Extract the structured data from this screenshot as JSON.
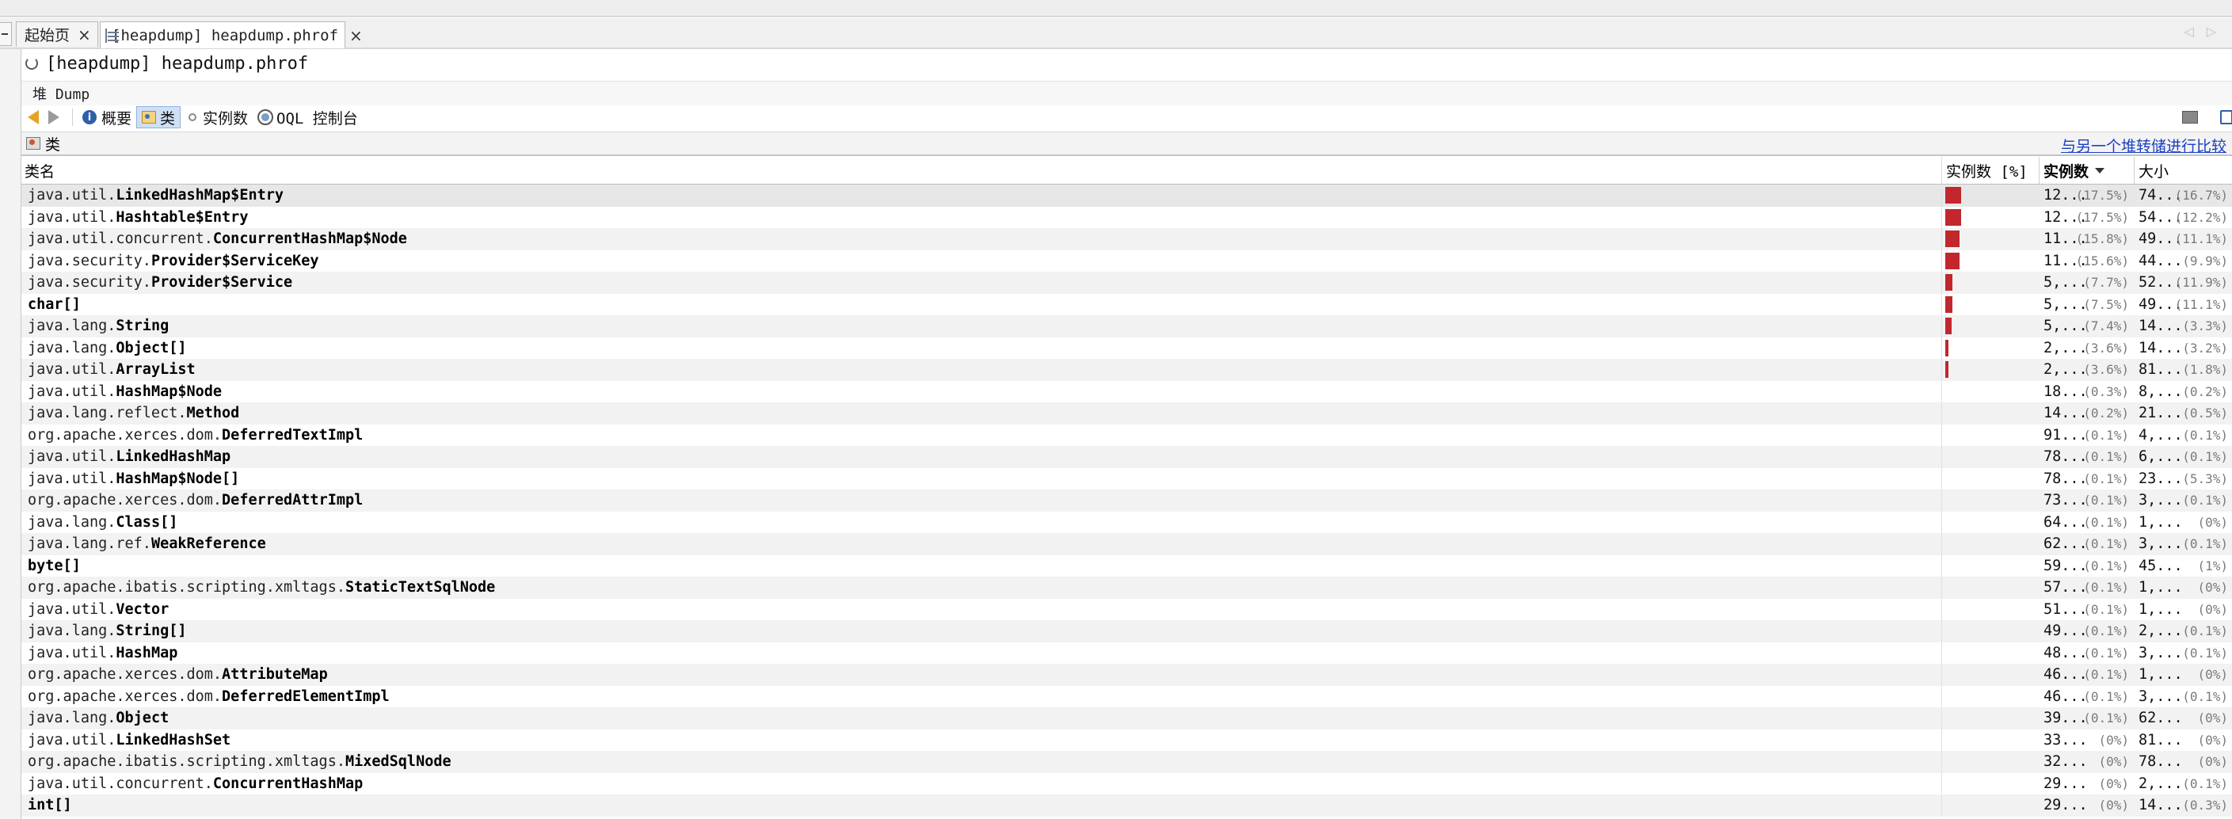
{
  "tabs": [
    {
      "label": "起始页",
      "close": "×"
    },
    {
      "label": "[heapdump] heapdump.phrof",
      "close": "×"
    }
  ],
  "tab_nav": {
    "left": "◁",
    "right": "▷"
  },
  "document": {
    "title": "[heapdump] heapdump.phrof",
    "heap_label": "堆 Dump"
  },
  "toolbar": {
    "summary_label": "概要",
    "classes_label": "类",
    "instances_label": "实例数",
    "oql_label": "OQL 控制台"
  },
  "section": {
    "title": "类",
    "compare_link": "与另一个堆转储进行比较"
  },
  "table": {
    "columns": {
      "name": "类名",
      "instances_pct": "实例数 [%]",
      "instances": "实例数",
      "size": "大小"
    },
    "rows": [
      {
        "pkg": "java.util.",
        "cls": "LinkedHashMap$Entry",
        "pct": 17.5,
        "count": "12...",
        "count_pct": "(17.5%)",
        "size": "74...",
        "size_pct": "(16.7%)"
      },
      {
        "pkg": "java.util.",
        "cls": "Hashtable$Entry",
        "pct": 17.5,
        "count": "12...",
        "count_pct": "(17.5%)",
        "size": "54...",
        "size_pct": "(12.2%)"
      },
      {
        "pkg": "java.util.concurrent.",
        "cls": "ConcurrentHashMap$Node",
        "pct": 15.8,
        "count": "11...",
        "count_pct": "(15.8%)",
        "size": "49...",
        "size_pct": "(11.1%)"
      },
      {
        "pkg": "java.security.",
        "cls": "Provider$ServiceKey",
        "pct": 15.6,
        "count": "11...",
        "count_pct": "(15.6%)",
        "size": "44...",
        "size_pct": "(9.9%)"
      },
      {
        "pkg": "java.security.",
        "cls": "Provider$Service",
        "pct": 7.7,
        "count": "5,...",
        "count_pct": "(7.7%)",
        "size": "52...",
        "size_pct": "(11.9%)"
      },
      {
        "pkg": "",
        "cls": "char[]",
        "pct": 7.5,
        "count": "5,...",
        "count_pct": "(7.5%)",
        "size": "49...",
        "size_pct": "(11.1%)"
      },
      {
        "pkg": "java.lang.",
        "cls": "String",
        "pct": 7.4,
        "count": "5,...",
        "count_pct": "(7.4%)",
        "size": "14...",
        "size_pct": "(3.3%)"
      },
      {
        "pkg": "java.lang.",
        "cls": "Object[]",
        "pct": 3.6,
        "count": "2,...",
        "count_pct": "(3.6%)",
        "size": "14...",
        "size_pct": "(3.2%)"
      },
      {
        "pkg": "java.util.",
        "cls": "ArrayList",
        "pct": 3.6,
        "count": "2,...",
        "count_pct": "(3.6%)",
        "size": "81...",
        "size_pct": "(1.8%)"
      },
      {
        "pkg": "java.util.",
        "cls": "HashMap$Node",
        "pct": 0.3,
        "count": "18...",
        "count_pct": "(0.3%)",
        "size": "8,...",
        "size_pct": "(0.2%)"
      },
      {
        "pkg": "java.lang.reflect.",
        "cls": "Method",
        "pct": 0.2,
        "count": "14...",
        "count_pct": "(0.2%)",
        "size": "21...",
        "size_pct": "(0.5%)"
      },
      {
        "pkg": "org.apache.xerces.dom.",
        "cls": "DeferredTextImpl",
        "pct": 0.1,
        "count": "91...",
        "count_pct": "(0.1%)",
        "size": "4,...",
        "size_pct": "(0.1%)"
      },
      {
        "pkg": "java.util.",
        "cls": "LinkedHashMap",
        "pct": 0.1,
        "count": "78...",
        "count_pct": "(0.1%)",
        "size": "6,...",
        "size_pct": "(0.1%)"
      },
      {
        "pkg": "java.util.",
        "cls": "HashMap$Node[]",
        "pct": 0.1,
        "count": "78...",
        "count_pct": "(0.1%)",
        "size": "23...",
        "size_pct": "(5.3%)"
      },
      {
        "pkg": "org.apache.xerces.dom.",
        "cls": "DeferredAttrImpl",
        "pct": 0.1,
        "count": "73...",
        "count_pct": "(0.1%)",
        "size": "3,...",
        "size_pct": "(0.1%)"
      },
      {
        "pkg": "java.lang.",
        "cls": "Class[]",
        "pct": 0.1,
        "count": "64...",
        "count_pct": "(0.1%)",
        "size": "1,...",
        "size_pct": "(0%)"
      },
      {
        "pkg": "java.lang.ref.",
        "cls": "WeakReference",
        "pct": 0.1,
        "count": "62...",
        "count_pct": "(0.1%)",
        "size": "3,...",
        "size_pct": "(0.1%)"
      },
      {
        "pkg": "",
        "cls": "byte[]",
        "pct": 0.1,
        "count": "59...",
        "count_pct": "(0.1%)",
        "size": "45...",
        "size_pct": "(1%)"
      },
      {
        "pkg": "org.apache.ibatis.scripting.xmltags.",
        "cls": "StaticTextSqlNode",
        "pct": 0.1,
        "count": "57...",
        "count_pct": "(0.1%)",
        "size": "1,...",
        "size_pct": "(0%)"
      },
      {
        "pkg": "java.util.",
        "cls": "Vector",
        "pct": 0.1,
        "count": "51...",
        "count_pct": "(0.1%)",
        "size": "1,...",
        "size_pct": "(0%)"
      },
      {
        "pkg": "java.lang.",
        "cls": "String[]",
        "pct": 0.1,
        "count": "49...",
        "count_pct": "(0.1%)",
        "size": "2,...",
        "size_pct": "(0.1%)"
      },
      {
        "pkg": "java.util.",
        "cls": "HashMap",
        "pct": 0.1,
        "count": "48...",
        "count_pct": "(0.1%)",
        "size": "3,...",
        "size_pct": "(0.1%)"
      },
      {
        "pkg": "org.apache.xerces.dom.",
        "cls": "AttributeMap",
        "pct": 0.1,
        "count": "46...",
        "count_pct": "(0.1%)",
        "size": "1,...",
        "size_pct": "(0%)"
      },
      {
        "pkg": "org.apache.xerces.dom.",
        "cls": "DeferredElementImpl",
        "pct": 0.1,
        "count": "46...",
        "count_pct": "(0.1%)",
        "size": "3,...",
        "size_pct": "(0.1%)"
      },
      {
        "pkg": "java.lang.",
        "cls": "Object",
        "pct": 0.1,
        "count": "39...",
        "count_pct": "(0.1%)",
        "size": "62...",
        "size_pct": "(0%)"
      },
      {
        "pkg": "java.util.",
        "cls": "LinkedHashSet",
        "pct": 0,
        "count": "33...",
        "count_pct": "(0%)",
        "size": "81...",
        "size_pct": "(0%)"
      },
      {
        "pkg": "org.apache.ibatis.scripting.xmltags.",
        "cls": "MixedSqlNode",
        "pct": 0,
        "count": "32...",
        "count_pct": "(0%)",
        "size": "78...",
        "size_pct": "(0%)"
      },
      {
        "pkg": "java.util.concurrent.",
        "cls": "ConcurrentHashMap",
        "pct": 0,
        "count": "29...",
        "count_pct": "(0%)",
        "size": "2,...",
        "size_pct": "(0.1%)"
      },
      {
        "pkg": "",
        "cls": "int[]",
        "pct": 0,
        "count": "29...",
        "count_pct": "(0%)",
        "size": "14...",
        "size_pct": "(0.3%)"
      }
    ]
  },
  "colors": {
    "bar": "#c1272d",
    "link": "#1a3fc2"
  }
}
